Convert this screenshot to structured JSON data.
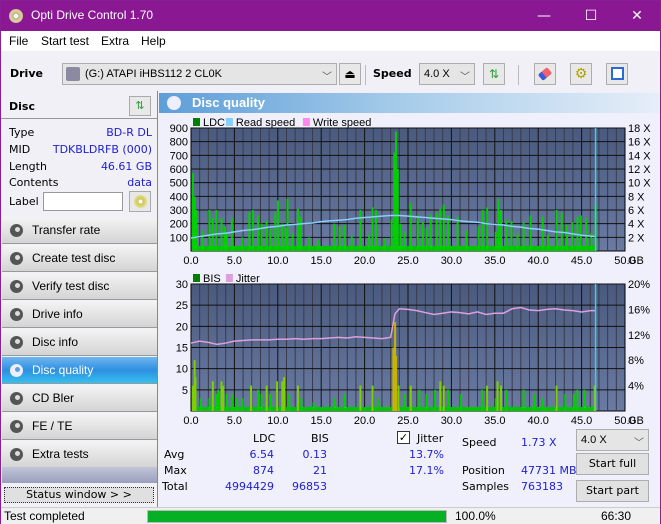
{
  "window": {
    "title": "Opti Drive Control 1.70",
    "controls": {
      "minimize": "—",
      "maximize": "☐",
      "close": "✕"
    }
  },
  "menu": [
    "File",
    "Start test",
    "Extra",
    "Help"
  ],
  "toolbar": {
    "drive_label": "Drive",
    "drive_value": "(G:)  ATAPI iHBS112  2 CL0K",
    "speed_label": "Speed",
    "speed_value": "4.0 X"
  },
  "disc": {
    "header": "Disc",
    "fields": [
      {
        "key": "Type",
        "value": "BD-R DL"
      },
      {
        "key": "MID",
        "value": "TDKBLDRFB (000)"
      },
      {
        "key": "Length",
        "value": "46.61 GB"
      },
      {
        "key": "Contents",
        "value": "data"
      }
    ],
    "label_key": "Label",
    "label_value": ""
  },
  "nav": [
    {
      "label": "Transfer rate",
      "active": false
    },
    {
      "label": "Create test disc",
      "active": false
    },
    {
      "label": "Verify test disc",
      "active": false
    },
    {
      "label": "Drive info",
      "active": false
    },
    {
      "label": "Disc info",
      "active": false
    },
    {
      "label": "Disc quality",
      "active": true
    },
    {
      "label": "CD Bler",
      "active": false
    },
    {
      "label": "FE / TE",
      "active": false
    },
    {
      "label": "Extra tests",
      "active": false
    }
  ],
  "status_window_label": "Status window > >",
  "panel_title": "Disc quality",
  "chart_data": [
    {
      "type": "bar",
      "title": "LDC / Read speed",
      "legend": [
        "LDC",
        "Read speed",
        "Write speed"
      ],
      "legend_colors": [
        "#008000",
        "#87cefa",
        "#ff88ee"
      ],
      "xlabel": "GB",
      "xlim": [
        0,
        50
      ],
      "x_ticks": [
        "0.0",
        "5.0",
        "10.0",
        "15.0",
        "20.0",
        "25.0",
        "30.0",
        "35.0",
        "40.0",
        "45.0",
        "50.0"
      ],
      "ylim_left": [
        0,
        900
      ],
      "y_ticks_left": [
        "100",
        "200",
        "300",
        "400",
        "500",
        "600",
        "700",
        "800",
        "900"
      ],
      "ylim_right": [
        0,
        18
      ],
      "y_ticks_right": [
        "2 X",
        "4 X",
        "6 X",
        "8 X",
        "10 X",
        "12 X",
        "14 X",
        "16 X",
        "18 X"
      ],
      "ldc_spikes": [
        [
          0.1,
          570
        ],
        [
          0.3,
          400
        ],
        [
          0.5,
          300
        ],
        [
          1.2,
          150
        ],
        [
          2.0,
          300
        ],
        [
          2.4,
          240
        ],
        [
          2.8,
          300
        ],
        [
          3.4,
          240
        ],
        [
          3.8,
          180
        ],
        [
          4.0,
          140
        ],
        [
          4.6,
          240
        ],
        [
          5.8,
          100
        ],
        [
          6.6,
          280
        ],
        [
          7.0,
          300
        ],
        [
          7.6,
          260
        ],
        [
          8.0,
          200
        ],
        [
          8.6,
          220
        ],
        [
          9.0,
          160
        ],
        [
          9.6,
          280
        ],
        [
          9.9,
          370
        ],
        [
          10.4,
          200
        ],
        [
          10.8,
          170
        ],
        [
          11.0,
          380
        ],
        [
          11.6,
          130
        ],
        [
          12.2,
          310
        ],
        [
          12.5,
          250
        ],
        [
          13.5,
          100
        ],
        [
          14.5,
          80
        ],
        [
          16.4,
          200
        ],
        [
          17.0,
          180
        ],
        [
          17.6,
          190
        ],
        [
          18.4,
          110
        ],
        [
          19.4,
          300
        ],
        [
          20.4,
          120
        ],
        [
          20.8,
          320
        ],
        [
          21.2,
          300
        ],
        [
          22.2,
          90
        ],
        [
          23.0,
          230
        ],
        [
          23.3,
          720
        ],
        [
          23.5,
          874
        ],
        [
          23.7,
          600
        ],
        [
          24.0,
          200
        ],
        [
          24.5,
          140
        ],
        [
          25.2,
          350
        ],
        [
          26.0,
          260
        ],
        [
          26.6,
          210
        ],
        [
          27.0,
          170
        ],
        [
          27.5,
          270
        ],
        [
          28.2,
          280
        ],
        [
          28.6,
          310
        ],
        [
          29.0,
          340
        ],
        [
          29.5,
          260
        ],
        [
          30.6,
          250
        ],
        [
          31.6,
          150
        ],
        [
          33.0,
          180
        ],
        [
          33.5,
          300
        ],
        [
          34.0,
          320
        ],
        [
          35.0,
          140
        ],
        [
          35.3,
          380
        ],
        [
          35.6,
          300
        ],
        [
          36.2,
          230
        ],
        [
          36.8,
          220
        ],
        [
          37.5,
          130
        ],
        [
          38.2,
          210
        ],
        [
          39.0,
          260
        ],
        [
          40.4,
          250
        ],
        [
          41.0,
          120
        ],
        [
          42.0,
          300
        ],
        [
          42.6,
          280
        ],
        [
          43.2,
          190
        ],
        [
          43.8,
          210
        ],
        [
          44.4,
          250
        ],
        [
          44.8,
          260
        ],
        [
          45.4,
          240
        ],
        [
          46.0,
          130
        ],
        [
          46.5,
          340
        ]
      ],
      "read_speed": [
        [
          0,
          1.9
        ],
        [
          1,
          2.1
        ],
        [
          2,
          2.3
        ],
        [
          3,
          2.5
        ],
        [
          4,
          2.6
        ],
        [
          5,
          2.8
        ],
        [
          6,
          3.0
        ],
        [
          7,
          3.1
        ],
        [
          8,
          3.3
        ],
        [
          9,
          3.5
        ],
        [
          10,
          3.6
        ],
        [
          11,
          3.8
        ],
        [
          12,
          3.9
        ],
        [
          13,
          4.0
        ],
        [
          14,
          4.1
        ],
        [
          15,
          4.3
        ],
        [
          16,
          4.4
        ],
        [
          17,
          4.5
        ],
        [
          18,
          4.6
        ],
        [
          19,
          4.8
        ],
        [
          20,
          4.9
        ],
        [
          21,
          5.0
        ],
        [
          22,
          5.1
        ],
        [
          23,
          5.2
        ],
        [
          24,
          5.2
        ],
        [
          25,
          5.1
        ],
        [
          26,
          5.0
        ],
        [
          27,
          4.9
        ],
        [
          28,
          4.8
        ],
        [
          29,
          4.7
        ],
        [
          30,
          4.6
        ],
        [
          31,
          4.4
        ],
        [
          32,
          4.3
        ],
        [
          33,
          4.2
        ],
        [
          34,
          4.0
        ],
        [
          35,
          3.9
        ],
        [
          36,
          3.8
        ],
        [
          37,
          3.6
        ],
        [
          38,
          3.5
        ],
        [
          39,
          3.3
        ],
        [
          40,
          3.2
        ],
        [
          41,
          3.0
        ],
        [
          42,
          2.8
        ],
        [
          43,
          2.7
        ],
        [
          44,
          2.5
        ],
        [
          45,
          2.3
        ],
        [
          46,
          2.2
        ],
        [
          46.6,
          2.1
        ]
      ],
      "end_marker_gb": 46.61
    },
    {
      "type": "bar",
      "title": "BIS / Jitter",
      "legend": [
        "BIS",
        "Jitter"
      ],
      "legend_colors": [
        "#008000",
        "#dda0dd"
      ],
      "xlabel": "GB",
      "xlim": [
        0,
        50
      ],
      "x_ticks": [
        "0.0",
        "5.0",
        "10.0",
        "15.0",
        "20.0",
        "25.0",
        "30.0",
        "35.0",
        "40.0",
        "45.0",
        "50.0"
      ],
      "ylim_left": [
        0,
        30
      ],
      "y_ticks_left": [
        "5",
        "10",
        "15",
        "20",
        "25",
        "30"
      ],
      "ylim_right": [
        0,
        20
      ],
      "y_ticks_right": [
        "4%",
        "8%",
        "12%",
        "16%",
        "20%"
      ],
      "bis_spikes": [
        [
          0.1,
          6
        ],
        [
          0.3,
          12
        ],
        [
          0.4,
          8
        ],
        [
          1.0,
          3
        ],
        [
          2.0,
          3
        ],
        [
          2.4,
          7
        ],
        [
          2.8,
          4
        ],
        [
          3.0,
          5
        ],
        [
          3.4,
          7
        ],
        [
          3.6,
          6
        ],
        [
          4.0,
          4
        ],
        [
          4.6,
          4
        ],
        [
          5.2,
          3
        ],
        [
          5.8,
          3
        ],
        [
          6.8,
          6
        ],
        [
          7.6,
          5
        ],
        [
          8.0,
          4
        ],
        [
          8.6,
          6
        ],
        [
          9.0,
          4
        ],
        [
          9.8,
          7
        ],
        [
          10.4,
          7
        ],
        [
          10.6,
          8
        ],
        [
          11.2,
          4
        ],
        [
          12.2,
          6
        ],
        [
          12.6,
          3
        ],
        [
          14.0,
          2
        ],
        [
          16.4,
          3
        ],
        [
          17.6,
          4
        ],
        [
          19.4,
          6
        ],
        [
          20.8,
          6
        ],
        [
          21.4,
          3
        ],
        [
          23.2,
          15
        ],
        [
          23.4,
          21
        ],
        [
          23.5,
          13
        ],
        [
          23.8,
          6
        ],
        [
          24.5,
          4
        ],
        [
          25.2,
          6
        ],
        [
          26.2,
          5
        ],
        [
          27.0,
          4
        ],
        [
          28.0,
          5
        ],
        [
          28.6,
          7
        ],
        [
          29.0,
          6
        ],
        [
          29.5,
          5
        ],
        [
          31.0,
          4
        ],
        [
          33.4,
          5
        ],
        [
          34.0,
          6
        ],
        [
          35.0,
          3
        ],
        [
          35.2,
          7
        ],
        [
          35.6,
          6
        ],
        [
          36.2,
          5
        ],
        [
          38.2,
          5
        ],
        [
          39.4,
          4
        ],
        [
          40.4,
          3
        ],
        [
          42.0,
          6
        ],
        [
          43.0,
          4
        ],
        [
          44.0,
          4
        ],
        [
          44.4,
          5
        ],
        [
          45.2,
          5
        ],
        [
          46.4,
          6
        ]
      ],
      "jitter": [
        [
          0,
          10.7
        ],
        [
          1,
          11.0
        ],
        [
          2,
          10.8
        ],
        [
          3,
          10.5
        ],
        [
          4,
          10.7
        ],
        [
          5,
          11.0
        ],
        [
          6,
          11.1
        ],
        [
          7,
          11.2
        ],
        [
          8,
          11.2
        ],
        [
          9,
          11.2
        ],
        [
          10,
          11.3
        ],
        [
          11,
          11.3
        ],
        [
          12,
          11.4
        ],
        [
          13,
          11.3
        ],
        [
          14,
          11.4
        ],
        [
          15,
          11.4
        ],
        [
          16,
          11.5
        ],
        [
          17,
          11.6
        ],
        [
          18,
          11.5
        ],
        [
          19,
          11.7
        ],
        [
          20,
          11.6
        ],
        [
          21,
          11.5
        ],
        [
          22,
          11.4
        ],
        [
          23,
          11.6
        ],
        [
          23.5,
          15.3
        ],
        [
          24,
          16.1
        ],
        [
          25,
          16.0
        ],
        [
          26,
          15.8
        ],
        [
          27,
          15.5
        ],
        [
          28,
          15.2
        ],
        [
          29,
          15.4
        ],
        [
          30,
          15.6
        ],
        [
          31,
          15.5
        ],
        [
          32,
          15.3
        ],
        [
          33,
          15.6
        ],
        [
          34,
          15.2
        ],
        [
          35,
          15.4
        ],
        [
          36,
          15.4
        ],
        [
          37,
          16.1
        ],
        [
          38,
          16.3
        ],
        [
          39,
          15.9
        ],
        [
          40,
          15.8
        ],
        [
          41,
          16.0
        ],
        [
          42,
          16.1
        ],
        [
          43,
          15.9
        ],
        [
          44,
          15.8
        ],
        [
          45,
          15.6
        ],
        [
          46,
          15.8
        ],
        [
          46.6,
          15.8
        ]
      ],
      "end_marker_gb": 46.61
    }
  ],
  "stats": {
    "col_ldc": "LDC",
    "col_bis": "BIS",
    "jitter_label": "Jitter",
    "jitter_checked": true,
    "rows": [
      {
        "label": "Avg",
        "ldc": "6.54",
        "bis": "0.13",
        "jitter": "13.7%"
      },
      {
        "label": "Max",
        "ldc": "874",
        "bis": "21",
        "jitter": "17.1%"
      },
      {
        "label": "Total",
        "ldc": "4994429",
        "bis": "96853",
        "jitter": ""
      }
    ],
    "speed_label": "Speed",
    "speed_value": "1.73 X",
    "position_label": "Position",
    "position_value": "47731 MB",
    "samples_label": "Samples",
    "samples_value": "763183",
    "speed_select": "4.0 X",
    "start_full": "Start full",
    "start_part": "Start part"
  },
  "statusbar": {
    "text": "Test completed",
    "progress_percent": 100,
    "progress_label": "100.0%",
    "time": "66:30"
  }
}
